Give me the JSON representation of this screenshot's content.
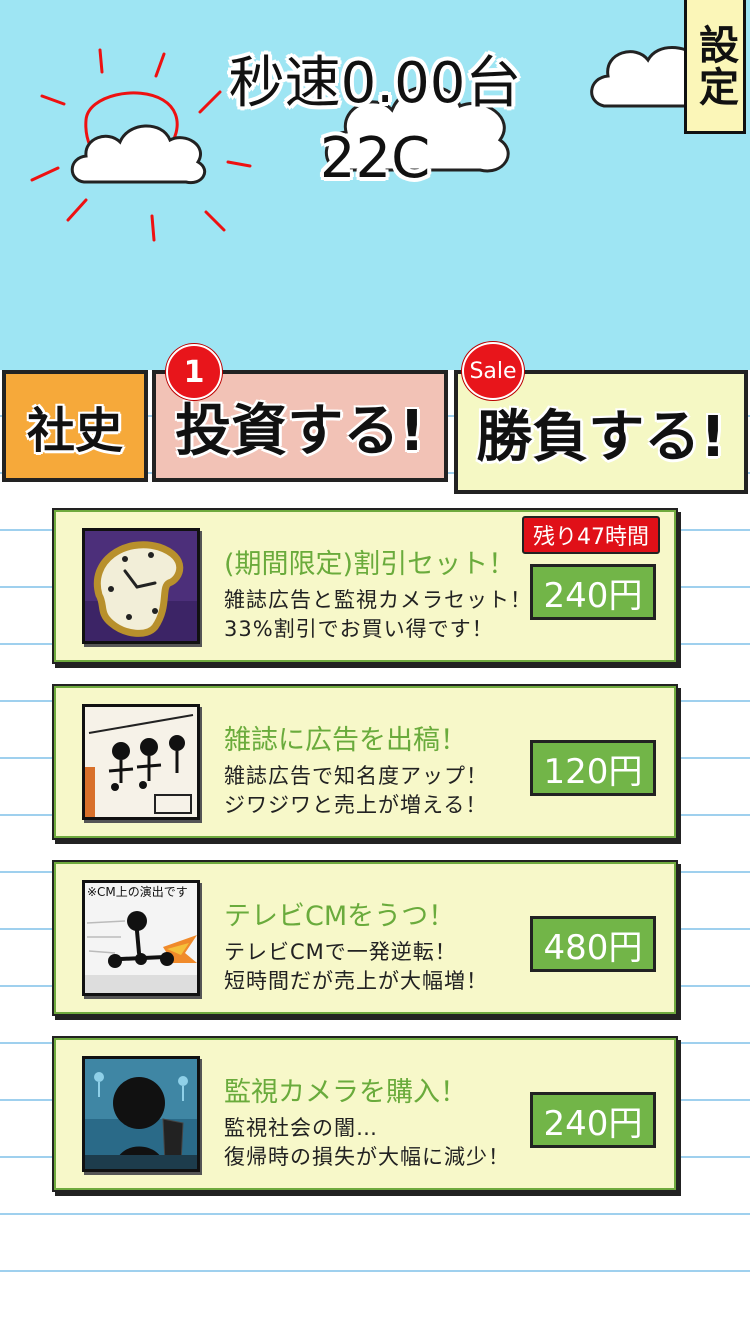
{
  "header": {
    "speed": "秒速0.00台",
    "money": "22C",
    "settings_label": "設定"
  },
  "tabs": {
    "history": "社史",
    "invest": "投資する!",
    "invest_badge": "1",
    "battle": "勝負する!",
    "battle_badge": "Sale"
  },
  "items": [
    {
      "title": "(期間限定)割引セット！",
      "desc1": "雑誌広告と監視カメラセット！",
      "desc2": "33%割引でお買い得です！",
      "price": "240円",
      "timer": "残り47時間",
      "icon": "melting-clock-icon"
    },
    {
      "title": "雑誌に広告を出稿！",
      "desc1": "雑誌広告で知名度アップ！",
      "desc2": "ジワジワと売上が増える！",
      "price": "120円",
      "icon": "magazine-icon"
    },
    {
      "title": "テレビCMをうつ！",
      "desc1": "テレビCMで一発逆転！",
      "desc2": "短時間だが売上が大幅増！",
      "price": "480円",
      "note": "※CM上の演出です",
      "icon": "tv-commercial-icon"
    },
    {
      "title": "監視カメラを購入！",
      "desc1": "監視社会の闇…",
      "desc2": "復帰時の損失が大幅に減少！",
      "price": "240円",
      "icon": "security-camera-icon"
    }
  ],
  "colors": {
    "sky": "#9ee5f3",
    "card_bg": "#f7f8c9",
    "price_bg": "#72b548",
    "title_green": "#6aab3c",
    "badge_red": "#e8151b"
  }
}
